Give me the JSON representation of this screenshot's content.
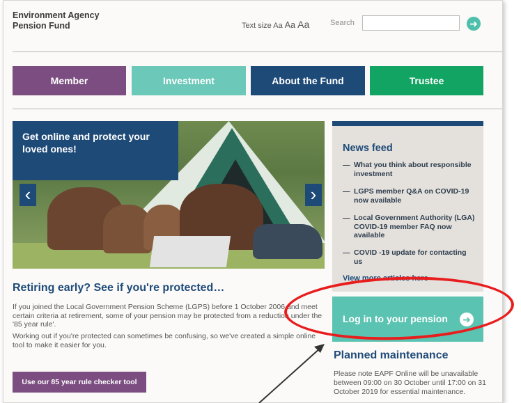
{
  "header": {
    "logo_line1": "Environment Agency",
    "logo_line2": "Pension Fund",
    "text_size_label": "Text size",
    "text_size_options": [
      "Aa",
      "Aa",
      "Aa"
    ],
    "search_label": "Search",
    "search_value": ""
  },
  "nav": {
    "items": [
      {
        "label": "Member",
        "color": "#7b4d80"
      },
      {
        "label": "Investment",
        "color": "#6cc8b8"
      },
      {
        "label": "About the Fund",
        "color": "#1e4a78"
      },
      {
        "label": "Trustee",
        "color": "#12a463"
      }
    ]
  },
  "hero": {
    "caption": "Get online and protect your loved ones!",
    "prev": "‹",
    "next": "›"
  },
  "news": {
    "title": "News feed",
    "items": [
      "What you think about responsible investment",
      "LGPS member Q&A on COVID-19 now available",
      "Local Government Authority (LGA) COVID-19 member FAQ now available",
      "COVID -19 update for contacting us"
    ],
    "more": "View more articles here"
  },
  "login": {
    "label": "Log in to your pension"
  },
  "maintenance": {
    "title": "Planned maintenance",
    "text": "Please note EAPF Online will be unavailable between 09:00 on 30 October until 17:00 on 31 October 2019 for essential maintenance."
  },
  "article": {
    "title": "Retiring early? See if you're protected…",
    "para1": "If you joined the Local Government Pension Scheme (LGPS) before 1 October 2006 and meet certain criteria at retirement, some of your pension may be protected from a reduction under the '85 year rule'.",
    "para2": "Working out if you're protected can sometimes be confusing, so we've created a simple online tool to make it easier for you.",
    "button": "Use our 85 year rule checker tool"
  },
  "colors": {
    "navy": "#1e4a78",
    "teal": "#5bc3b1",
    "purple": "#7b4d80",
    "green": "#12a463",
    "highlight_red": "#e81d1d"
  }
}
